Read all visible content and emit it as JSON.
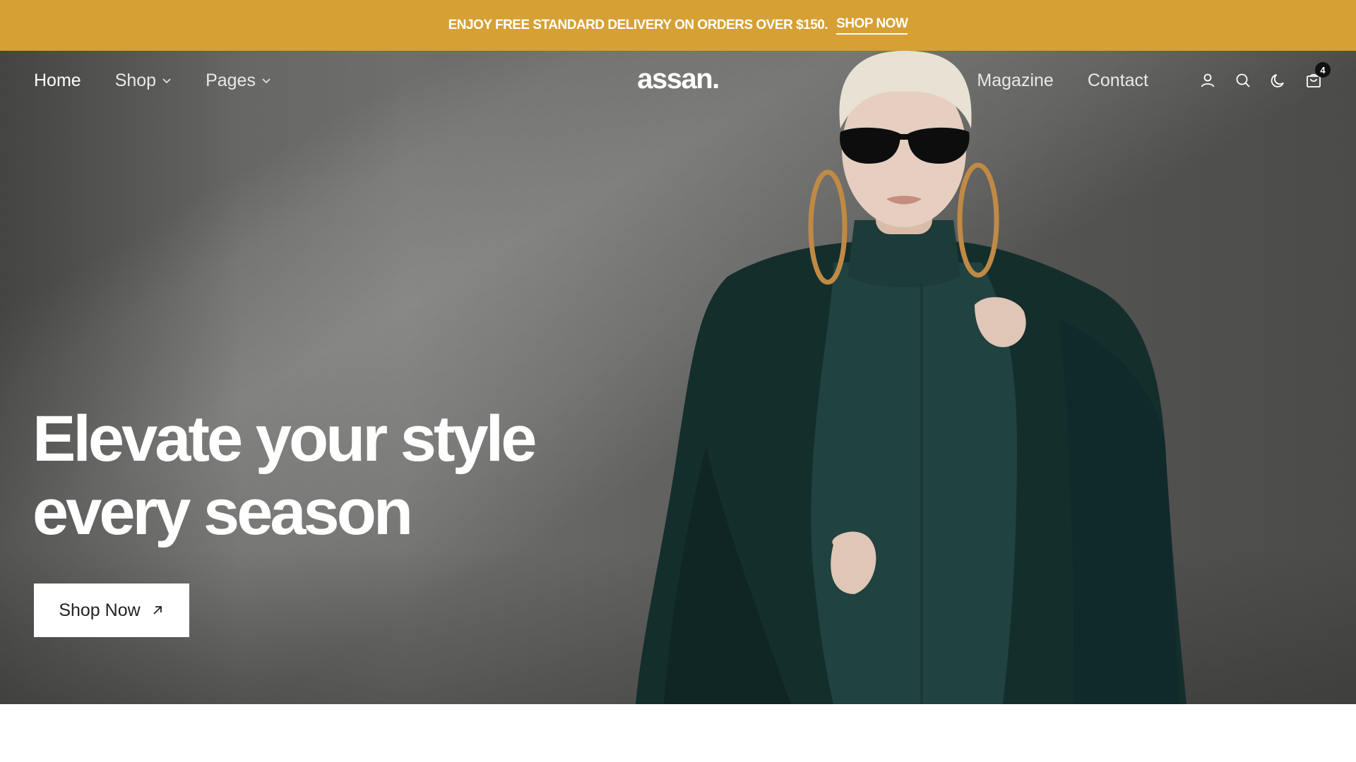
{
  "announcement": {
    "text": "ENJOY FREE STANDARD DELIVERY ON ORDERS OVER $150.",
    "link": "SHOP NOW",
    "background": "#d6a034"
  },
  "nav": {
    "left": [
      {
        "label": "Home",
        "active": true
      },
      {
        "label": "Shop",
        "dropdown": true
      },
      {
        "label": "Pages",
        "dropdown": true
      }
    ],
    "logo": "assan.",
    "right": [
      {
        "label": "Magazine"
      },
      {
        "label": "Contact"
      }
    ],
    "icons": [
      "user-icon",
      "search-icon",
      "moon-icon",
      "bag-icon"
    ],
    "cart_count": "4"
  },
  "hero": {
    "headline_line1": "Elevate your style",
    "headline_line2": "every season",
    "cta_label": "Shop Now"
  }
}
